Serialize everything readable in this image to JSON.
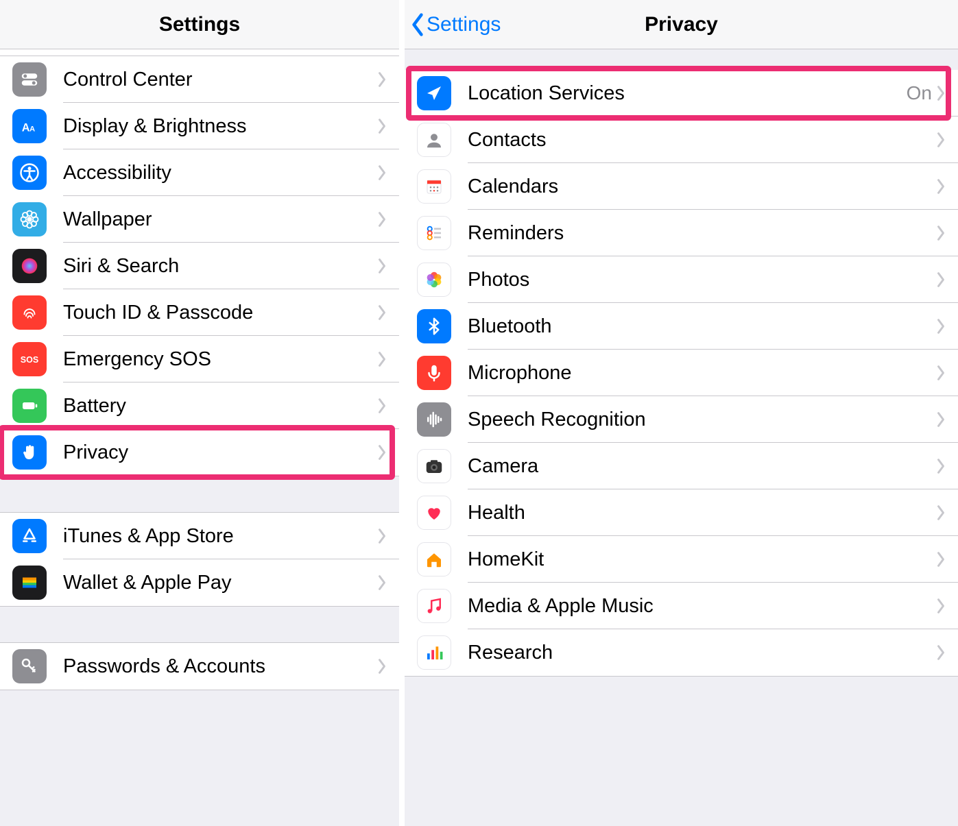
{
  "left": {
    "title": "Settings",
    "groups": [
      {
        "id": "g1",
        "items": [
          {
            "id": "control-center",
            "label": "Control Center",
            "icon": "toggles",
            "bg": "bg-gray"
          },
          {
            "id": "display",
            "label": "Display & Brightness",
            "icon": "aa",
            "bg": "bg-blue"
          },
          {
            "id": "accessibility",
            "label": "Accessibility",
            "icon": "access",
            "bg": "bg-blue"
          },
          {
            "id": "wallpaper",
            "label": "Wallpaper",
            "icon": "flower",
            "bg": "bg-teal"
          },
          {
            "id": "siri",
            "label": "Siri & Search",
            "icon": "siri",
            "bg": "bg-dark"
          },
          {
            "id": "touchid",
            "label": "Touch ID & Passcode",
            "icon": "finger",
            "bg": "bg-red"
          },
          {
            "id": "sos",
            "label": "Emergency SOS",
            "icon": "sos",
            "bg": "bg-redsos"
          },
          {
            "id": "battery",
            "label": "Battery",
            "icon": "battery",
            "bg": "bg-green"
          },
          {
            "id": "privacy",
            "label": "Privacy",
            "icon": "hand",
            "bg": "bg-blue",
            "highlight": true
          }
        ]
      },
      {
        "id": "g2",
        "items": [
          {
            "id": "itunes",
            "label": "iTunes & App Store",
            "icon": "appstore",
            "bg": "bg-blue"
          },
          {
            "id": "wallet",
            "label": "Wallet & Apple Pay",
            "icon": "wallet",
            "bg": "bg-dark"
          }
        ]
      },
      {
        "id": "g3",
        "items": [
          {
            "id": "passwords",
            "label": "Passwords & Accounts",
            "icon": "key",
            "bg": "bg-gray"
          }
        ]
      }
    ]
  },
  "right": {
    "title": "Privacy",
    "back_label": "Settings",
    "groups": [
      {
        "id": "rg1",
        "items": [
          {
            "id": "location",
            "label": "Location Services",
            "detail": "On",
            "icon": "location",
            "bg": "bg-blue",
            "highlight": true
          },
          {
            "id": "contacts",
            "label": "Contacts",
            "icon": "contacts",
            "bg": "bg-white"
          },
          {
            "id": "calendars",
            "label": "Calendars",
            "icon": "calendar",
            "bg": "bg-white"
          },
          {
            "id": "reminders",
            "label": "Reminders",
            "icon": "reminders",
            "bg": "bg-white"
          },
          {
            "id": "photos",
            "label": "Photos",
            "icon": "photos",
            "bg": "bg-white"
          },
          {
            "id": "bluetooth",
            "label": "Bluetooth",
            "icon": "bluetooth",
            "bg": "bg-blue"
          },
          {
            "id": "microphone",
            "label": "Microphone",
            "icon": "mic",
            "bg": "bg-red"
          },
          {
            "id": "speech",
            "label": "Speech Recognition",
            "icon": "wave",
            "bg": "bg-gray2"
          },
          {
            "id": "camera",
            "label": "Camera",
            "icon": "camera",
            "bg": "bg-white"
          },
          {
            "id": "health",
            "label": "Health",
            "icon": "heart",
            "bg": "bg-white"
          },
          {
            "id": "homekit",
            "label": "HomeKit",
            "icon": "home",
            "bg": "bg-white"
          },
          {
            "id": "media",
            "label": "Media & Apple Music",
            "icon": "music",
            "bg": "bg-white"
          },
          {
            "id": "research",
            "label": "Research",
            "icon": "bars",
            "bg": "bg-white"
          }
        ]
      }
    ]
  },
  "colors": {
    "highlight": "#ec2d72",
    "link": "#007aff"
  }
}
